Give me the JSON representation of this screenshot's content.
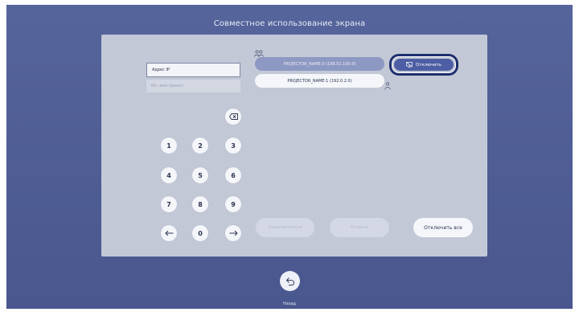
{
  "screen": {
    "title": "Совместное использование экрана"
  },
  "inputs": {
    "ip_label": "Адрес IP",
    "name_placeholder": "Ип. имя проект."
  },
  "keypad": {
    "backspace_icon": "backspace-icon",
    "keys": [
      "1",
      "2",
      "3",
      "4",
      "5",
      "6",
      "7",
      "8",
      "9",
      "0"
    ],
    "left_icon": "arrow-left-icon",
    "right_icon": "arrow-right-icon"
  },
  "projectors": [
    {
      "name": "PROJECTOR_NAME:0 (198.51.100.0)",
      "state": "selected"
    },
    {
      "name": "PROJECTOR_NAME:1 (192.0.2.0)",
      "state": "normal"
    }
  ],
  "actions": {
    "disconnect": "Отключить",
    "connect": "Подключаться",
    "cancel": "Отмена",
    "disconnect_all": "Отключить все"
  },
  "footer": {
    "back_label": "Назад"
  },
  "colors": {
    "background": "#4f5c94",
    "panel": "#c2c8d6",
    "accent": "#4d5ea4",
    "focus": "#1d2f6e"
  }
}
